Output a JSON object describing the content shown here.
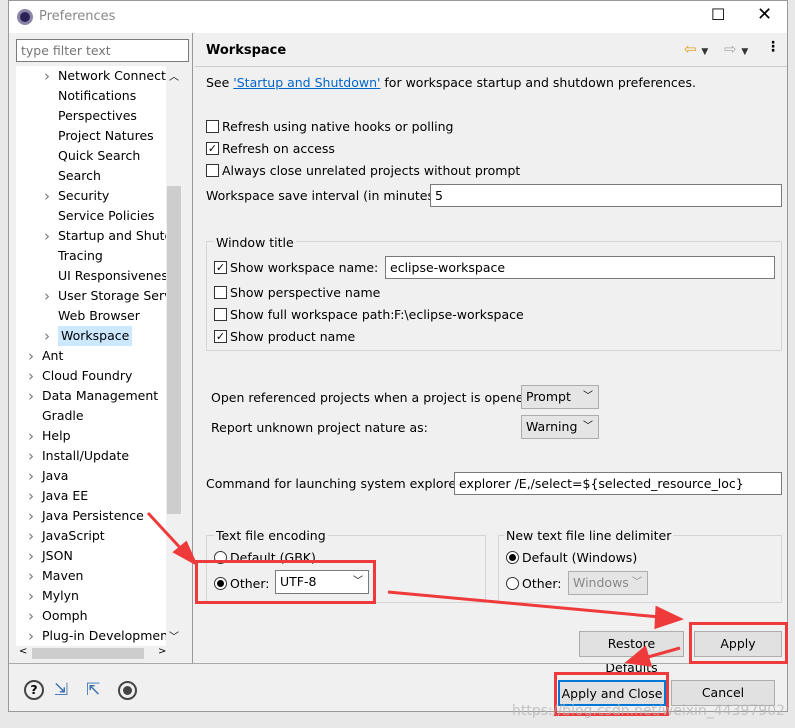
{
  "window": {
    "title": "Preferences"
  },
  "filter": {
    "placeholder": "type filter text"
  },
  "tree": [
    {
      "label": "Network Connectio",
      "level": 1,
      "expandable": true
    },
    {
      "label": "Notifications",
      "level": 1,
      "expandable": false
    },
    {
      "label": "Perspectives",
      "level": 1,
      "expandable": false
    },
    {
      "label": "Project Natures",
      "level": 1,
      "expandable": false
    },
    {
      "label": "Quick Search",
      "level": 1,
      "expandable": false
    },
    {
      "label": "Search",
      "level": 1,
      "expandable": false
    },
    {
      "label": "Security",
      "level": 1,
      "expandable": true
    },
    {
      "label": "Service Policies",
      "level": 1,
      "expandable": false
    },
    {
      "label": "Startup and Shutdo",
      "level": 1,
      "expandable": true
    },
    {
      "label": "Tracing",
      "level": 1,
      "expandable": false
    },
    {
      "label": "UI Responsiveness",
      "level": 1,
      "expandable": false
    },
    {
      "label": "User Storage Servic",
      "level": 1,
      "expandable": true
    },
    {
      "label": "Web Browser",
      "level": 1,
      "expandable": false
    },
    {
      "label": "Workspace",
      "level": 1,
      "expandable": true,
      "selected": true
    },
    {
      "label": "Ant",
      "level": 0,
      "expandable": true
    },
    {
      "label": "Cloud Foundry",
      "level": 0,
      "expandable": true
    },
    {
      "label": "Data Management",
      "level": 0,
      "expandable": true
    },
    {
      "label": "Gradle",
      "level": 0,
      "expandable": false
    },
    {
      "label": "Help",
      "level": 0,
      "expandable": true
    },
    {
      "label": "Install/Update",
      "level": 0,
      "expandable": true
    },
    {
      "label": "Java",
      "level": 0,
      "expandable": true
    },
    {
      "label": "Java EE",
      "level": 0,
      "expandable": true
    },
    {
      "label": "Java Persistence",
      "level": 0,
      "expandable": true
    },
    {
      "label": "JavaScript",
      "level": 0,
      "expandable": true
    },
    {
      "label": "JSON",
      "level": 0,
      "expandable": true
    },
    {
      "label": "Maven",
      "level": 0,
      "expandable": true
    },
    {
      "label": "Mylyn",
      "level": 0,
      "expandable": true
    },
    {
      "label": "Oomph",
      "level": 0,
      "expandable": true
    },
    {
      "label": "Plug-in Development",
      "level": 0,
      "expandable": true
    }
  ],
  "page": {
    "title": "Workspace",
    "see_prefix": "See ",
    "see_link": "'Startup and Shutdown'",
    "see_suffix": " for workspace startup and shutdown preferences.",
    "refresh_native": {
      "label": "Refresh using native hooks or polling",
      "checked": false
    },
    "refresh_access": {
      "label": "Refresh on access",
      "checked": true
    },
    "always_close": {
      "label": "Always close unrelated projects without prompt",
      "checked": false
    },
    "save_interval": {
      "label": "Workspace save interval (in minutes):",
      "value": "5"
    },
    "window_title": {
      "legend": "Window title",
      "show_ws_name": {
        "label": "Show workspace name:",
        "checked": true,
        "value": "eclipse-workspace"
      },
      "show_perspective": {
        "label": "Show perspective name",
        "checked": false
      },
      "show_full_path": {
        "label": "Show full workspace path:",
        "checked": false,
        "value": "F:\\eclipse-workspace"
      },
      "show_product": {
        "label": "Show product name",
        "checked": true
      }
    },
    "open_ref": {
      "label": "Open referenced projects when a project is opened:",
      "value": "Prompt"
    },
    "unknown_nature": {
      "label": "Report unknown project nature as:",
      "value": "Warning"
    },
    "sys_explorer": {
      "label": "Command for launching system explorer:",
      "value": "explorer /E,/select=${selected_resource_loc}"
    },
    "encoding": {
      "legend": "Text file encoding",
      "default_label": "Default (GBK)",
      "other_label": "Other:",
      "other_selected": true,
      "value": "UTF-8"
    },
    "delimiter": {
      "legend": "New text file line delimiter",
      "default_label": "Default (Windows)",
      "default_selected": true,
      "other_label": "Other:",
      "value": "Windows"
    },
    "restore_defaults": "Restore Defaults",
    "apply": "Apply"
  },
  "footer": {
    "apply_close": "Apply and Close",
    "cancel": "Cancel"
  },
  "watermark": "https://blog.csdn.net/weixin_44397902",
  "colors": {
    "annotation": "#ee3a3a",
    "link": "#0066cc",
    "focus": "#0078d7"
  }
}
